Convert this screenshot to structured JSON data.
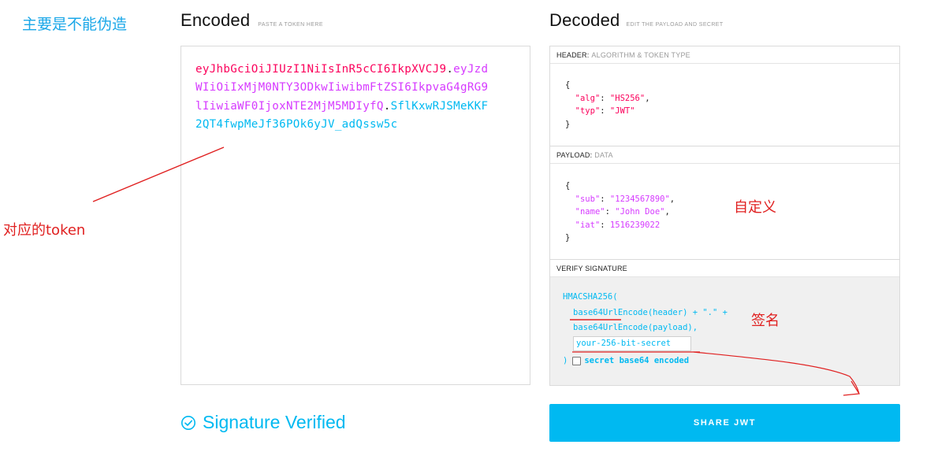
{
  "annotations": {
    "top_left": "主要是不能伪造",
    "token_label": "对应的token",
    "payload_label": "自定义",
    "signature_label": "签名"
  },
  "encoded": {
    "title": "Encoded",
    "subtitle": "PASTE A TOKEN HERE",
    "token": {
      "header": "eyJhbGciOiJIUzI1NiIsInR5cCI6IkpXVCJ9",
      "dot1": ".",
      "payload": "eyJzdWIiOiIxMjM0NTY3ODkwIiwibmFtZSI6IkpvaG4gRG9lIiwiaWF0IjoxNTE2MjM5MDIyfQ",
      "dot2": ".",
      "signature": "SflKxwRJSMeKKF2QT4fwpMeJf36POk6yJV_adQssw5c"
    }
  },
  "decoded": {
    "title": "Decoded",
    "subtitle": "EDIT THE PAYLOAD AND SECRET",
    "header_section": {
      "label": "HEADER:",
      "sublabel": "ALGORITHM & TOKEN TYPE",
      "open": "{",
      "alg_key": "\"alg\"",
      "alg_val": "\"HS256\"",
      "typ_key": "\"typ\"",
      "typ_val": "\"JWT\"",
      "close": "}"
    },
    "payload_section": {
      "label": "PAYLOAD:",
      "sublabel": "DATA",
      "open": "{",
      "sub_key": "\"sub\"",
      "sub_val": "\"1234567890\"",
      "name_key": "\"name\"",
      "name_val": "\"John Doe\"",
      "iat_key": "\"iat\"",
      "iat_val": "1516239022",
      "close": "}"
    },
    "verify_section": {
      "label": "VERIFY SIGNATURE",
      "line1": "HMACSHA256(",
      "line2": "base64UrlEncode(header) + \".\" +",
      "line3": "base64UrlEncode(payload),",
      "secret_value": "your-256-bit-secret",
      "close_paren": ")",
      "checkbox_label": "secret base64 encoded"
    }
  },
  "status": {
    "verified_text": "Signature Verified"
  },
  "share_button": "SHARE JWT",
  "colors": {
    "header": "#fb015b",
    "payload": "#d63aff",
    "signature": "#00b9f1",
    "annotation": "#e02020"
  }
}
